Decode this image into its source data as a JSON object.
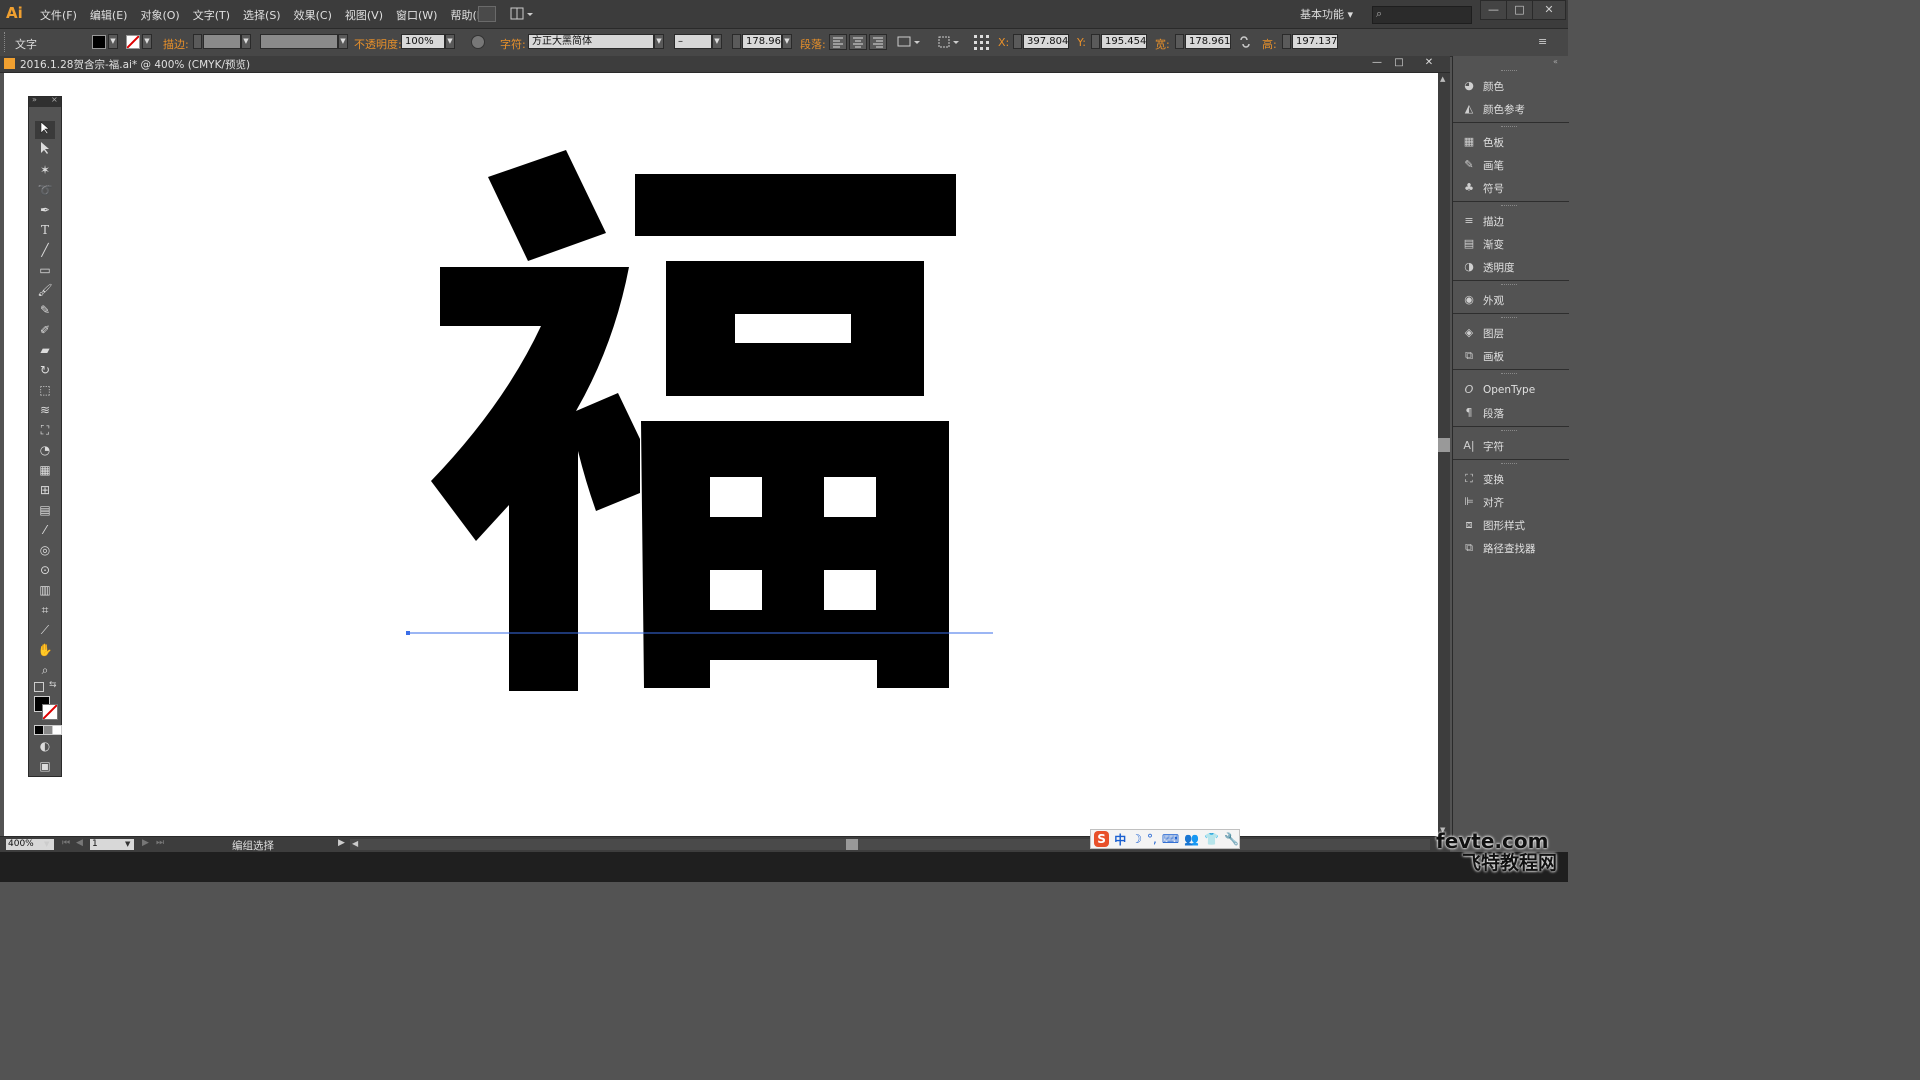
{
  "app": {
    "logo": "Ai",
    "menu": [
      "文件(F)",
      "编辑(E)",
      "对象(O)",
      "文字(T)",
      "选择(S)",
      "效果(C)",
      "视图(V)",
      "窗口(W)",
      "帮助(H)"
    ],
    "workspace": "基本功能",
    "window_buttons": [
      "—",
      "□",
      "✕"
    ]
  },
  "control_bar": {
    "selection_type": "文字",
    "stroke_label": "描边:",
    "opacity_label": "不透明度:",
    "opacity_value": "100%",
    "character_label": "字符:",
    "font_family": "方正大黑简体",
    "font_style": "–",
    "font_size": "178.96",
    "paragraph_label": "段落:",
    "x_label": "X:",
    "x_value": "397.804",
    "y_label": "Y:",
    "y_value": "195.454",
    "w_label": "宽:",
    "w_value": "178.961",
    "h_label": "高:",
    "h_value": "197.137",
    "fill_color": "#000000",
    "accent_label_color": "#e8902a"
  },
  "document": {
    "title": "2016.1.28贺含宗-福.ai* @ 400% (CMYK/预览)",
    "controls": [
      "—",
      "□",
      "✕"
    ],
    "canvas_color": "#ffffff",
    "glyph": "福",
    "guide_color": "#3a6ee8"
  },
  "tools": [
    "selection-tool",
    "direct-selection-tool",
    "magic-wand-tool",
    "lasso-tool",
    "pen-tool",
    "type-tool",
    "line-tool",
    "rectangle-tool",
    "paintbrush-tool",
    "pencil-tool",
    "blob-brush-tool",
    "eraser-tool",
    "rotate-tool",
    "scale-tool",
    "warp-tool",
    "free-transform-tool",
    "shape-builder-tool",
    "perspective-grid-tool",
    "mesh-tool",
    "gradient-tool",
    "eyedropper-tool",
    "blend-tool",
    "symbol-sprayer-tool",
    "column-graph-tool",
    "artboard-tool",
    "slice-tool",
    "hand-tool",
    "zoom-tool"
  ],
  "panels": [
    {
      "label": "颜色",
      "icon": "color-icon"
    },
    {
      "label": "颜色参考",
      "icon": "color-guide-icon"
    },
    {
      "label": "色板",
      "icon": "swatches-icon"
    },
    {
      "label": "画笔",
      "icon": "brushes-icon"
    },
    {
      "label": "符号",
      "icon": "symbols-icon"
    },
    {
      "label": "描边",
      "icon": "stroke-icon"
    },
    {
      "label": "渐变",
      "icon": "gradient-icon"
    },
    {
      "label": "透明度",
      "icon": "transparency-icon"
    },
    {
      "label": "外观",
      "icon": "appearance-icon"
    },
    {
      "label": "图层",
      "icon": "layers-icon"
    },
    {
      "label": "画板",
      "icon": "artboards-icon"
    },
    {
      "label": "OpenType",
      "icon": "opentype-icon"
    },
    {
      "label": "段落",
      "icon": "paragraph-icon"
    },
    {
      "label": "字符",
      "icon": "character-icon"
    },
    {
      "label": "变换",
      "icon": "transform-icon"
    },
    {
      "label": "对齐",
      "icon": "align-icon"
    },
    {
      "label": "图形样式",
      "icon": "graphic-styles-icon"
    },
    {
      "label": "路径查找器",
      "icon": "pathfinder-icon"
    }
  ],
  "status_bar": {
    "zoom": "400%",
    "page": "1",
    "status": "编组选择"
  },
  "ime": {
    "logo": "S",
    "mode": "中"
  },
  "watermark": {
    "line1": "fevte.com",
    "line2": "飞特教程网"
  }
}
